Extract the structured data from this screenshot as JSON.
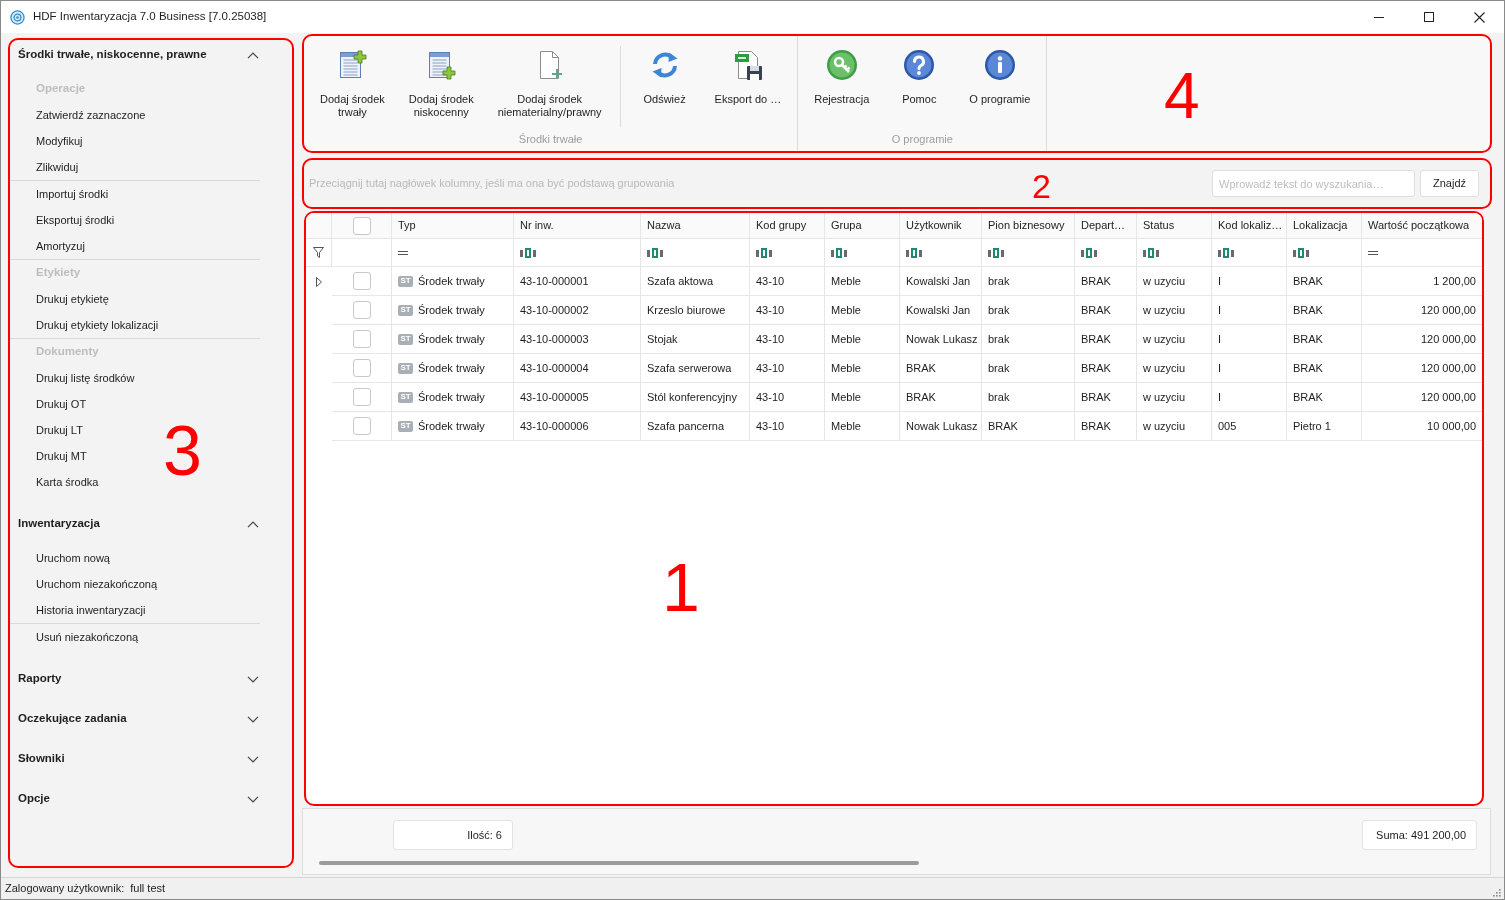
{
  "window": {
    "title": "HDF Inwentaryzacja 7.0 Business [7.0.25038]"
  },
  "sidebar": {
    "annotation": "3",
    "sections": [
      {
        "title": "Środki trwałe, niskocenne, prawne",
        "expanded": true,
        "groups": [
          {
            "heading": "Operacje",
            "items": [
              "Zatwierdź zaznaczone",
              "Modyfikuj",
              "Zlikwiduj"
            ]
          },
          {
            "items": [
              "Importuj środki",
              "Eksportuj środki",
              "Amortyzuj"
            ]
          },
          {
            "heading": "Etykiety",
            "items": [
              "Drukuj etykietę",
              "Drukuj etykiety lokalizacji"
            ]
          },
          {
            "heading": "Dokumenty",
            "items": [
              "Drukuj listę środków",
              "Drukuj OT",
              "Drukuj LT",
              "Drukuj MT",
              "Karta środka"
            ]
          }
        ]
      },
      {
        "title": "Inwentaryzacja",
        "expanded": true,
        "groups": [
          {
            "items": [
              "Uruchom nową",
              "Uruchom niezakończoną",
              "Historia inwentaryzacji"
            ]
          },
          {
            "items": [
              "Usuń niezakończoną"
            ]
          }
        ]
      },
      {
        "title": "Raporty",
        "expanded": false
      },
      {
        "title": "Oczekujące zadania",
        "expanded": false
      },
      {
        "title": "Słowniki",
        "expanded": false
      },
      {
        "title": "Opcje",
        "expanded": false
      }
    ]
  },
  "toolbar": {
    "annotation": "4",
    "groups": [
      {
        "label": "Środki trwałe",
        "sets": [
          [
            "Dodaj środek\ntrwały",
            "Dodaj środek\nniskocenny",
            "Dodaj środek\nniematerialny/prawny"
          ],
          [
            "Odśwież",
            "Eksport do …"
          ]
        ]
      },
      {
        "label": "O programie",
        "sets": [
          [
            "Rejestracja",
            "Pomoc",
            "O programie"
          ]
        ]
      }
    ]
  },
  "group_panel": {
    "annotation": "2",
    "hint": "Przeciągnij tutaj nagłówek kolumny, jeśli ma ona być podstawą grupowania",
    "search": {
      "placeholder": "Wprowadź tekst do wyszukania…"
    },
    "search_button": "Znajdź"
  },
  "table": {
    "annotation": "1",
    "select_all_checked": false,
    "columns": [
      {
        "label": "Typ",
        "kind": "type"
      },
      {
        "label": "Nr inw.",
        "kind": "text"
      },
      {
        "label": "Nazwa",
        "kind": "text"
      },
      {
        "label": "Kod grupy",
        "kind": "text"
      },
      {
        "label": "Grupa",
        "kind": "text"
      },
      {
        "label": "Użytkownik",
        "kind": "text"
      },
      {
        "label": "Pion biznesowy",
        "kind": "text"
      },
      {
        "label": "Depart…",
        "kind": "text"
      },
      {
        "label": "Status",
        "kind": "text"
      },
      {
        "label": "Kod lokaliz…",
        "kind": "text"
      },
      {
        "label": "Lokalizacja",
        "kind": "text"
      },
      {
        "label": "Wartość początkowa",
        "kind": "number"
      }
    ],
    "rows": [
      {
        "focused": true,
        "checked": false,
        "badge": "ST",
        "cells": [
          "Środek trwały",
          "43-10-000001",
          "Szafa aktowa",
          "43-10",
          "Meble",
          "Kowalski Jan",
          "brak",
          "BRAK",
          "w uzyciu",
          "I",
          "BRAK",
          "1 200,00"
        ]
      },
      {
        "focused": false,
        "checked": false,
        "badge": "ST",
        "cells": [
          "Środek trwały",
          "43-10-000002",
          "Krzeslo biurowe",
          "43-10",
          "Meble",
          "Kowalski Jan",
          "brak",
          "BRAK",
          "w uzyciu",
          "I",
          "BRAK",
          "120 000,00"
        ]
      },
      {
        "focused": false,
        "checked": false,
        "badge": "ST",
        "cells": [
          "Środek trwały",
          "43-10-000003",
          "Stojak",
          "43-10",
          "Meble",
          "Nowak Lukasz",
          "brak",
          "BRAK",
          "w uzyciu",
          "I",
          "BRAK",
          "120 000,00"
        ]
      },
      {
        "focused": false,
        "checked": false,
        "badge": "ST",
        "cells": [
          "Środek trwały",
          "43-10-000004",
          "Szafa serwerowa",
          "43-10",
          "Meble",
          "BRAK",
          "brak",
          "BRAK",
          "w uzyciu",
          "I",
          "BRAK",
          "120 000,00"
        ]
      },
      {
        "focused": false,
        "checked": false,
        "badge": "ST",
        "cells": [
          "Środek trwały",
          "43-10-000005",
          "Stól konferencyjny",
          "43-10",
          "Meble",
          "BRAK",
          "brak",
          "BRAK",
          "w uzyciu",
          "I",
          "BRAK",
          "120 000,00"
        ]
      },
      {
        "focused": false,
        "checked": false,
        "badge": "ST",
        "cells": [
          "Środek trwały",
          "43-10-000006",
          "Szafa pancerna",
          "43-10",
          "Meble",
          "Nowak Lukasz",
          "BRAK",
          "BRAK",
          "w uzyciu",
          "005",
          "Pietro 1",
          "10 000,00"
        ]
      }
    ]
  },
  "footer": {
    "count": "Ilość: 6",
    "sum": "Suma: 491 200,00"
  },
  "status_bar": {
    "label": "Zalogowany użytkownik:",
    "value": "full test"
  }
}
